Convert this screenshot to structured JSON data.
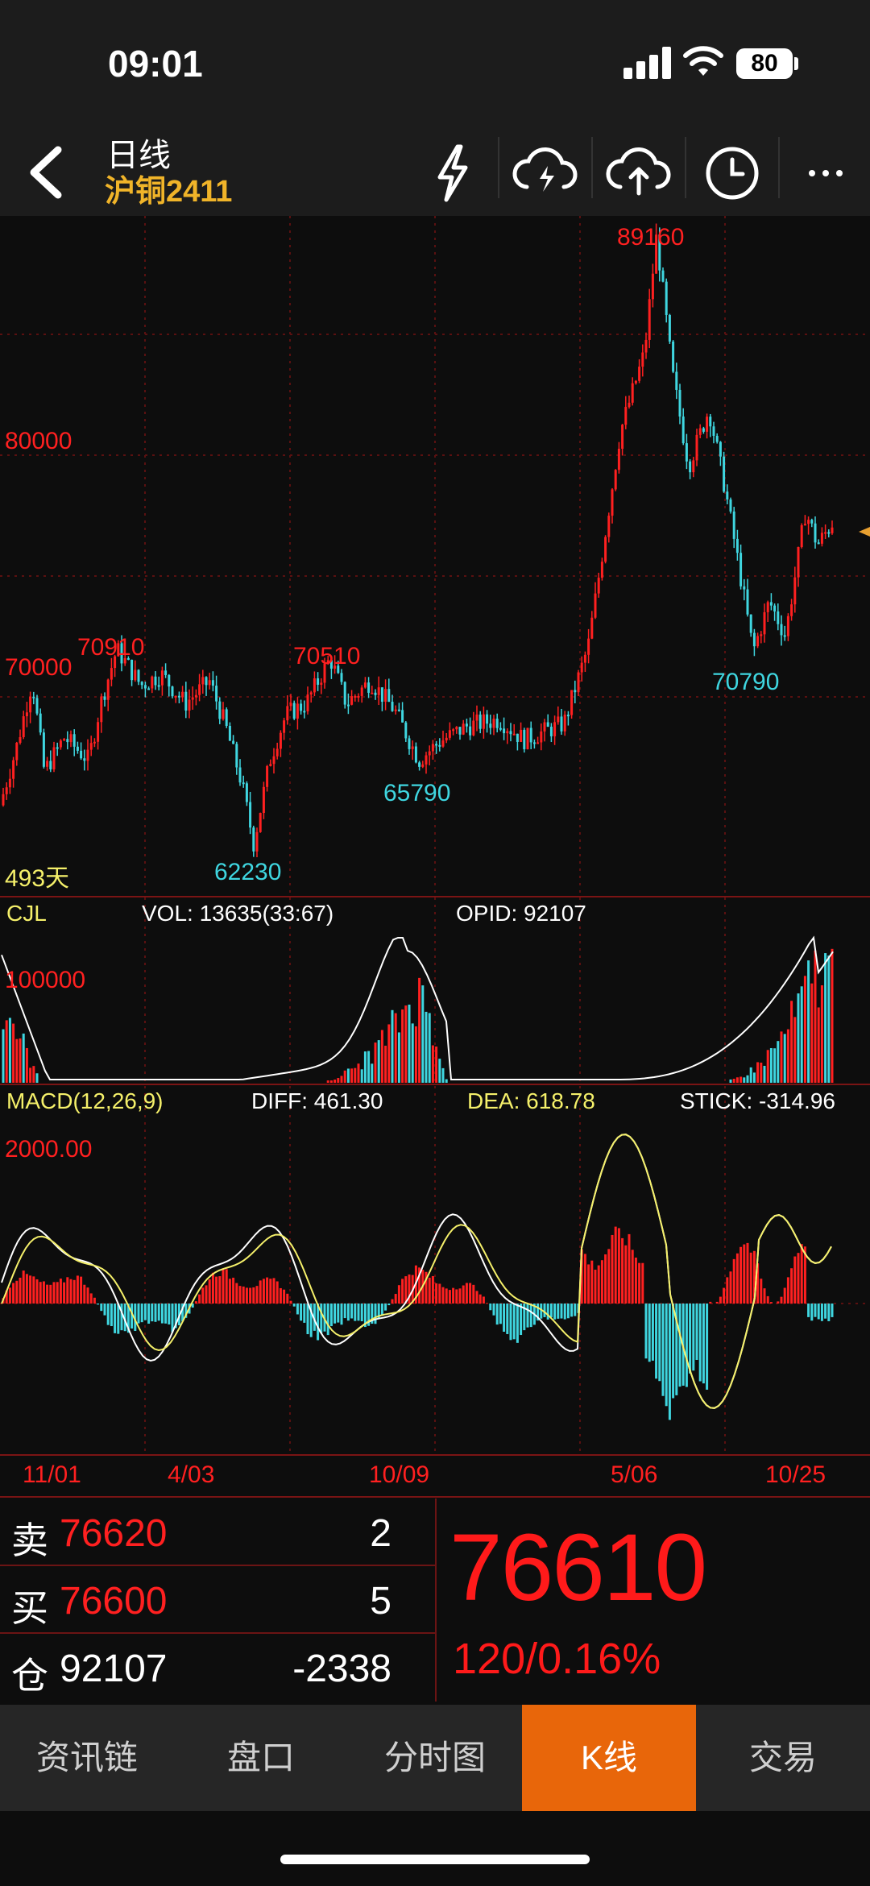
{
  "status": {
    "time": "09:01",
    "battery": "80"
  },
  "header": {
    "title": "日线",
    "subtitle": "沪铜2411"
  },
  "icons": [
    "back-arrow-icon",
    "flash-icon",
    "cloud-download-icon",
    "cloud-upload-icon",
    "clock-icon",
    "more-icon"
  ],
  "chart_data": {
    "type": "candlestick",
    "price_axis": {
      "label_80000": "80000",
      "label_70000": "70000"
    },
    "annotations": {
      "high_main": "89160",
      "high_left": "70910",
      "high_mid": "70510",
      "low_left": "62230",
      "low_mid": "65790",
      "low_right": "70790",
      "days": "493天"
    },
    "volume": {
      "label": "CJL",
      "vol": "VOL: 13635(33:67)",
      "opid": "OPID: 92107",
      "axis": "100000"
    },
    "macd": {
      "label": "MACD(12,26,9)",
      "diff": "DIFF: 461.30",
      "dea": "DEA: 618.78",
      "stick": "STICK: -314.96",
      "axis": "2000.00"
    },
    "x_ticks": [
      "11/01",
      "4/03",
      "10/09",
      "5/06",
      "10/25"
    ],
    "colors": {
      "up": "#ff2020",
      "down": "#3fd6e0",
      "ma": "#ffffff",
      "ma2": "#f5f06a"
    }
  },
  "quote": {
    "sell_label": "卖",
    "sell_price": "76620",
    "sell_qty": "2",
    "buy_label": "买",
    "buy_price": "76600",
    "buy_qty": "5",
    "oi_label": "仓",
    "oi_value": "92107",
    "oi_change": "-2338",
    "last": "76610",
    "change": "120/0.16%"
  },
  "tabs": [
    "资讯链",
    "盘口",
    "分时图",
    "K线",
    "交易"
  ]
}
